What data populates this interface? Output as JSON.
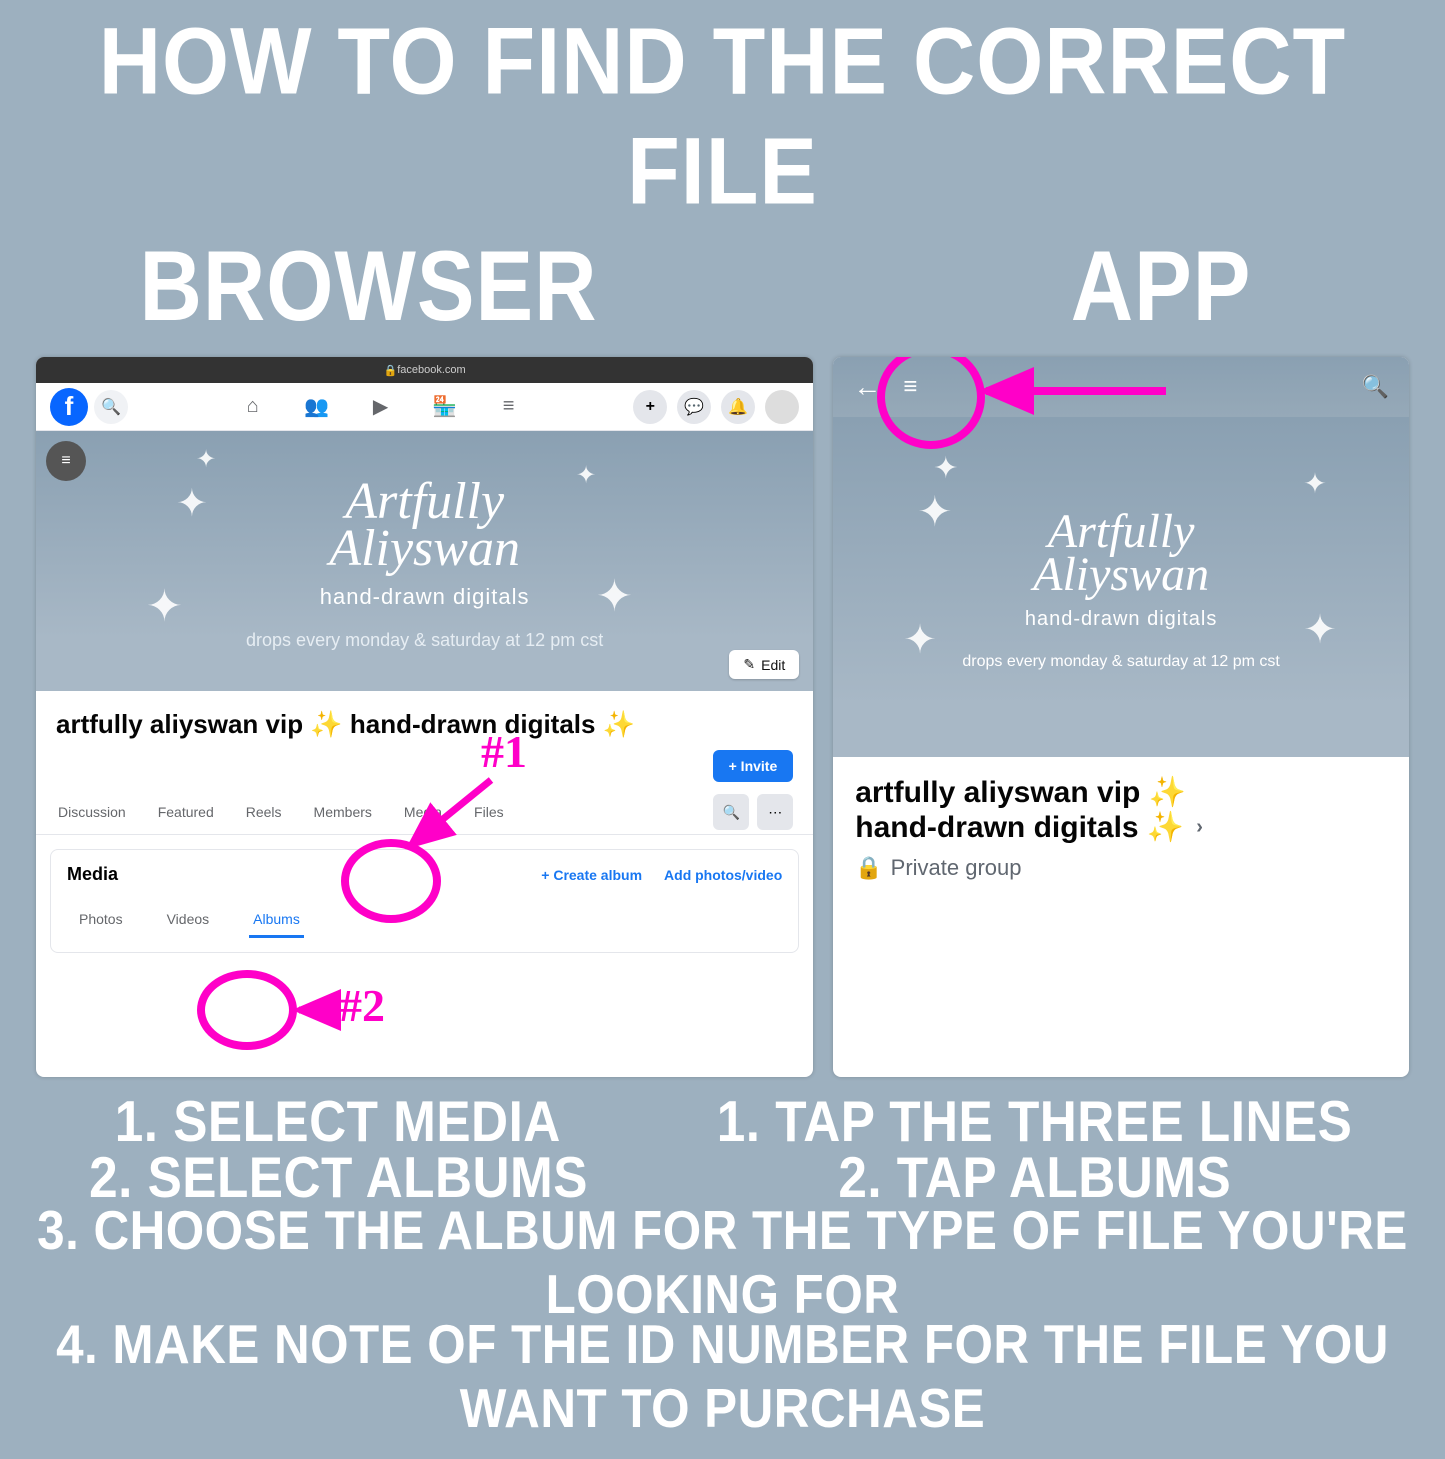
{
  "title": "HOW TO FIND THE CORRECT FILE",
  "subtitles": {
    "browser": "BROWSER",
    "app": "APP"
  },
  "browser": {
    "urlbar": "facebook.com",
    "cover": {
      "script1": "Artfully",
      "script2": "Aliyswan",
      "sub1": "hand-drawn digitals",
      "sub2": "drops every monday & saturday at 12 pm cst"
    },
    "edit_label": "Edit",
    "group_name": "artfully aliyswan vip ✨ hand-drawn digitals ✨",
    "invite_label": "+ Invite",
    "tabs": [
      "Discussion",
      "Featured",
      "Reels",
      "Members",
      "Media",
      "Files"
    ],
    "media_card": {
      "title": "Media",
      "create_album": "+  Create album",
      "add_photos": "Add photos/video",
      "subtabs": [
        "Photos",
        "Videos",
        "Albums"
      ],
      "active_subtab": "Albums"
    },
    "annotations": {
      "a1": "#1",
      "a2": "#2"
    }
  },
  "app": {
    "cover": {
      "script1": "Artfully",
      "script2": "Aliyswan",
      "sub1": "hand-drawn digitals",
      "sub2": "drops every monday & saturday at 12 pm cst"
    },
    "group_name_line1": "artfully aliyswan vip ✨",
    "group_name_line2": "hand-drawn digitals ✨",
    "privacy": "Private group"
  },
  "instructions": {
    "browser": [
      "1. SELECT MEDIA",
      "2. SELECT ALBUMS"
    ],
    "app": [
      "1. TAP THE THREE LINES",
      "2. TAP ALBUMS"
    ],
    "common": [
      "3. CHOOSE THE ALBUM FOR THE TYPE OF FILE YOU'RE LOOKING FOR",
      "4. MAKE NOTE OF THE ID NUMBER FOR THE FILE YOU WANT TO PURCHASE"
    ]
  }
}
